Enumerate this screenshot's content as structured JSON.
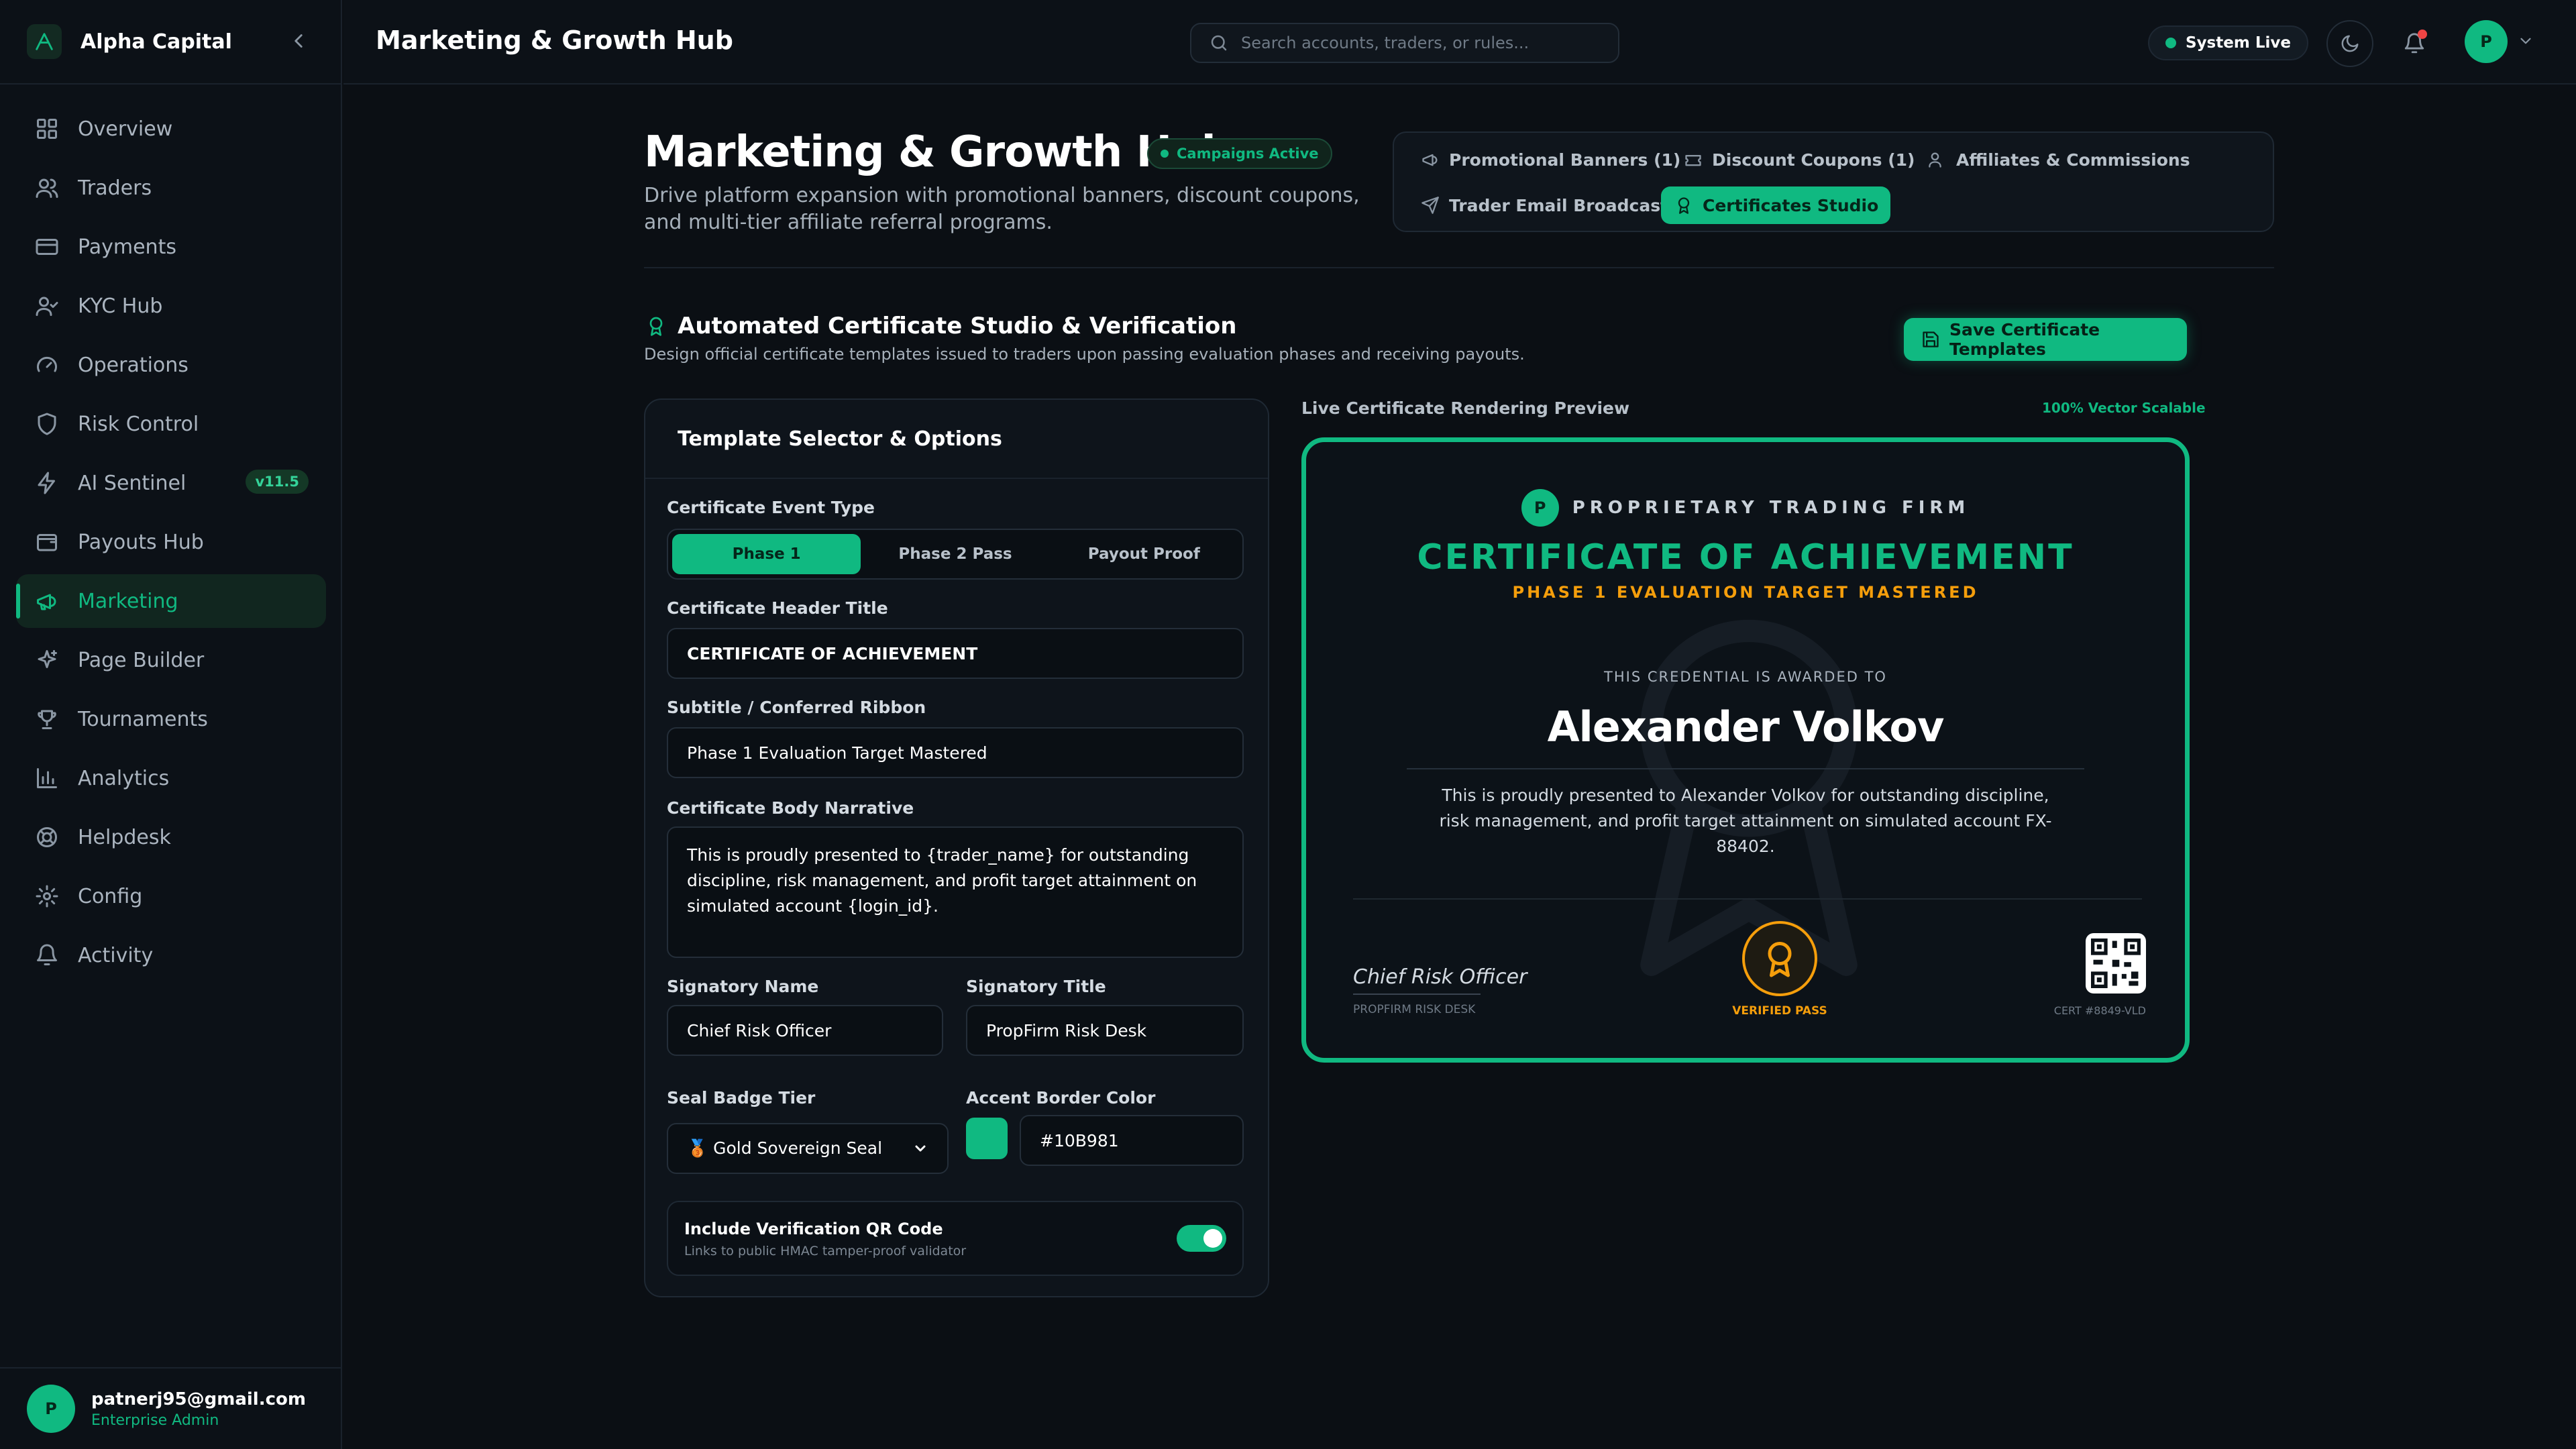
{
  "brand": {
    "name": "Alpha Capital"
  },
  "nav": [
    {
      "label": "Overview",
      "icon": "grid-icon"
    },
    {
      "label": "Traders",
      "icon": "users-icon"
    },
    {
      "label": "Payments",
      "icon": "credit-card-icon"
    },
    {
      "label": "KYC Hub",
      "icon": "user-check-icon"
    },
    {
      "label": "Operations",
      "icon": "gauge-icon"
    },
    {
      "label": "Risk Control",
      "icon": "shield-icon"
    },
    {
      "label": "AI Sentinel",
      "icon": "zap-icon",
      "badge": "v11.5"
    },
    {
      "label": "Payouts Hub",
      "icon": "wallet-icon"
    },
    {
      "label": "Marketing",
      "icon": "megaphone-icon",
      "active": true
    },
    {
      "label": "Page Builder",
      "icon": "sparkles-icon"
    },
    {
      "label": "Tournaments",
      "icon": "trophy-icon"
    },
    {
      "label": "Analytics",
      "icon": "bar-chart-icon"
    },
    {
      "label": "Helpdesk",
      "icon": "lifebuoy-icon"
    },
    {
      "label": "Config",
      "icon": "gear-icon"
    },
    {
      "label": "Activity",
      "icon": "bell-icon"
    }
  ],
  "user": {
    "initial": "P",
    "email": "patnerj95@gmail.com",
    "role": "Enterprise Admin"
  },
  "topbar": {
    "title": "Marketing & Growth Hub",
    "search_placeholder": "Search accounts, traders, or rules...",
    "status": "System Live",
    "avatar_initial": "P"
  },
  "page": {
    "title": "Marketing & Growth Hub",
    "badge": "Campaigns Active",
    "description": "Drive platform expansion with promotional banners, discount coupons, and multi-tier affiliate referral programs."
  },
  "tabs": [
    {
      "label": "Promotional Banners (1)",
      "icon": "megaphone-icon"
    },
    {
      "label": "Discount Coupons (1)",
      "icon": "ticket-icon"
    },
    {
      "label": "Affiliates & Commissions",
      "icon": "users-icon"
    },
    {
      "label": "Trader Email Broadcast",
      "icon": "send-icon"
    },
    {
      "label": "Certificates Studio",
      "icon": "award-icon",
      "active": true
    }
  ],
  "studio": {
    "title": "Automated Certificate Studio & Verification",
    "description": "Design official certificate templates issued to traders upon passing evaluation phases and receiving payouts.",
    "save_label": "Save Certificate Templates"
  },
  "options": {
    "panel_title": "Template Selector & Options",
    "event_type_label": "Certificate Event Type",
    "event_types": [
      "Phase 1",
      "Phase 2 Pass",
      "Payout Proof"
    ],
    "header_label": "Certificate Header Title",
    "header_value": "CERTIFICATE OF ACHIEVEMENT",
    "subtitle_label": "Subtitle / Conferred Ribbon",
    "subtitle_value": "Phase 1 Evaluation Target Mastered",
    "body_label": "Certificate Body Narrative",
    "body_value": "This is proudly presented to {trader_name} for outstanding discipline, risk management, and profit target attainment on simulated account {login_id}.",
    "signatory_name_label": "Signatory Name",
    "signatory_name_value": "Chief Risk Officer",
    "signatory_title_label": "Signatory Title",
    "signatory_title_value": "PropFirm Risk Desk",
    "seal_label": "Seal Badge Tier",
    "seal_value": "🥉 Gold Sovereign Seal",
    "accent_label": "Accent Border Color",
    "accent_value": "#10B981",
    "qr_title": "Include Verification QR Code",
    "qr_sub": "Links to public HMAC tamper-proof validator",
    "qr_enabled": true
  },
  "preview": {
    "label": "Live Certificate Rendering Preview",
    "scalable": "100% Vector Scalable",
    "logo_initial": "P",
    "firm": "PROPRIETARY TRADING FIRM",
    "title": "CERTIFICATE OF ACHIEVEMENT",
    "subtitle": "PHASE 1 EVALUATION TARGET MASTERED",
    "awarded": "THIS CREDENTIAL IS AWARDED TO",
    "name": "Alexander Volkov",
    "body": "This is proudly presented to Alexander Volkov for outstanding discipline, risk management, and profit target attainment on simulated account FX-88402.",
    "signature": "Chief Risk Officer",
    "signatory_title": "PROPFIRM RISK DESK",
    "seal_label": "VERIFIED PASS",
    "cert_id": "CERT #8849-VLD"
  },
  "colors": {
    "accent": "#10B981",
    "gold": "#F59E0B",
    "bg": "#0B0F14"
  }
}
